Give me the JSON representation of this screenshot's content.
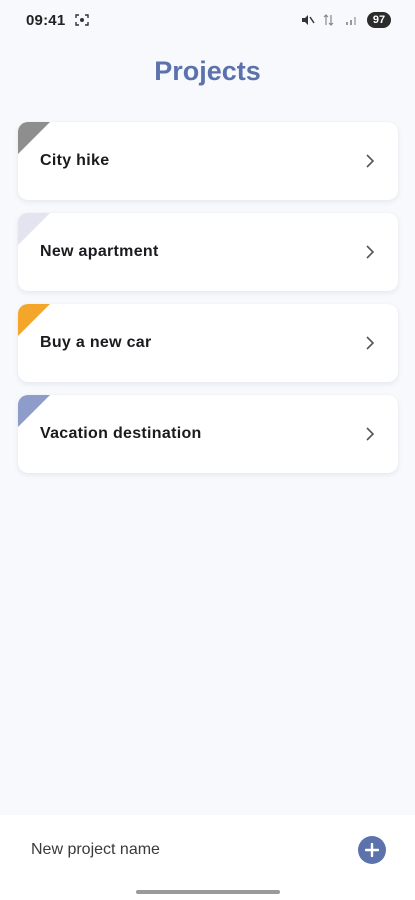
{
  "status_bar": {
    "time": "09:41",
    "battery": "97"
  },
  "header": {
    "title": "Projects"
  },
  "projects": [
    {
      "name": "City hike",
      "color": "#8e8e8e"
    },
    {
      "name": "New apartment",
      "color": "#e2e4ef"
    },
    {
      "name": "Buy a new car",
      "color": "#f4a62a"
    },
    {
      "name": "Vacation destination",
      "color": "#8d9cc9"
    }
  ],
  "new_project": {
    "placeholder": "New project name"
  },
  "colors": {
    "accent": "#5b72ad",
    "background": "#f7f9fc"
  },
  "icons": {
    "screenshot": "screenshot-icon",
    "mute": "mute-icon",
    "signal_data": "data-signal-icon",
    "signal": "signal-icon",
    "chevron": "chevron-right-icon",
    "add": "plus-circle-icon"
  }
}
